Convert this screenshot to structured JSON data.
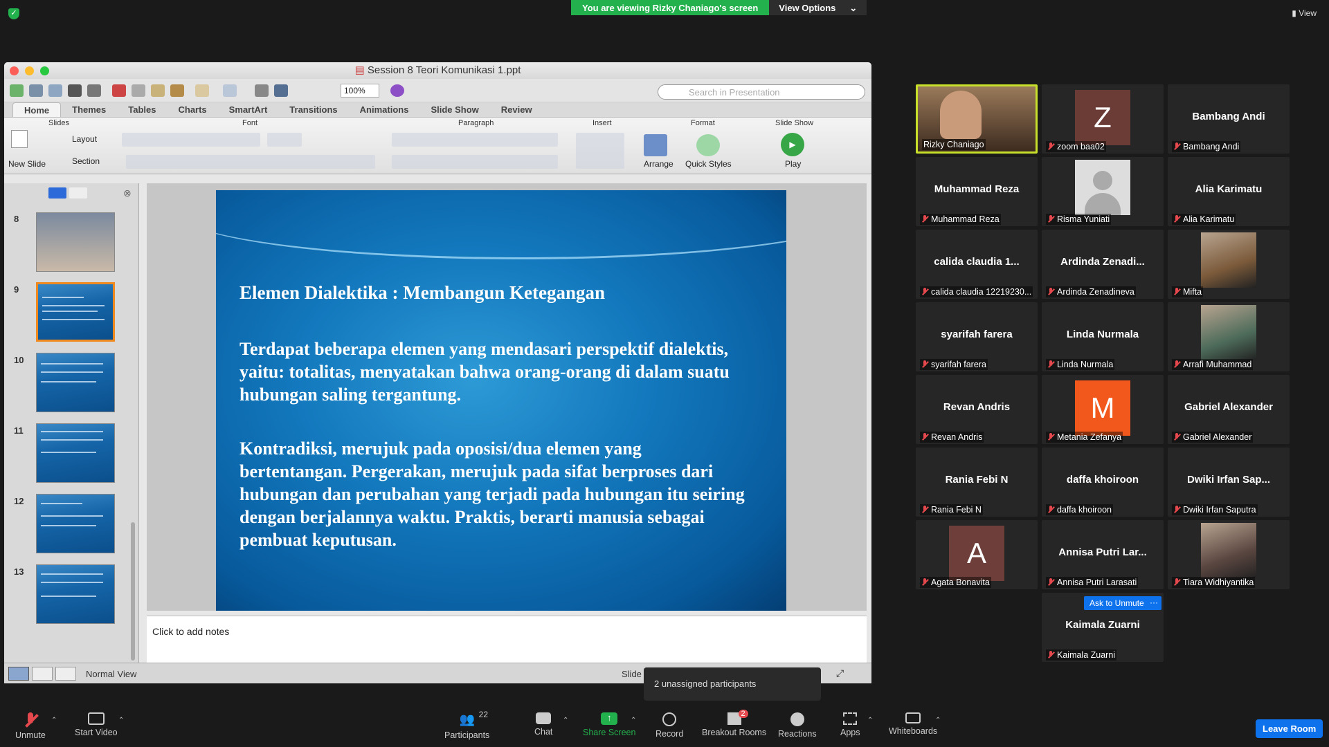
{
  "zoom_top": {
    "banner": "You are viewing Rizky Chaniago's screen",
    "view_options": "View Options",
    "view": "View"
  },
  "ppt": {
    "title": "Session 8 Teori Komunikasi 1.ppt",
    "zoom": "100%",
    "search_placeholder": "Search in Presentation",
    "tabs": [
      "Home",
      "Themes",
      "Tables",
      "Charts",
      "SmartArt",
      "Transitions",
      "Animations",
      "Slide Show",
      "Review"
    ],
    "groups": {
      "slides": "Slides",
      "font": "Font",
      "paragraph": "Paragraph",
      "insert": "Insert",
      "format": "Format",
      "slideshow": "Slide Show"
    },
    "buttons": {
      "new_slide": "New Slide",
      "layout": "Layout",
      "section": "Section",
      "arrange": "Arrange",
      "quick_styles": "Quick Styles",
      "play": "Play"
    },
    "thumb_numbers": [
      "8",
      "9",
      "10",
      "11",
      "12",
      "13"
    ],
    "slide": {
      "title": "Elemen Dialektika : Membangun Ketegangan",
      "p1": "Terdapat beberapa elemen yang mendasari perspektif dialektis, yaitu: totalitas, menyatakan bahwa orang-orang di dalam suatu hubungan saling tergantung.",
      "p2": "Kontradiksi, merujuk pada oposisi/dua elemen yang bertentangan. Pergerakan, merujuk pada sifat berproses dari hubungan dan perubahan yang terjadi pada hubungan itu seiring dengan berjalannya waktu. Praktis, berarti manusia sebagai pembuat keputusan."
    },
    "notes": "Click to add notes",
    "status_view": "Normal View",
    "status_slide": "Slide"
  },
  "participants": [
    {
      "big": "",
      "name": "Rizky Chaniago",
      "type": "video"
    },
    {
      "big": "",
      "name": "zoom baa02",
      "type": "avatar",
      "letter": "Z",
      "color": "#6b3b35"
    },
    {
      "big": "Bambang Andi",
      "name": "Bambang Andi",
      "type": "text"
    },
    {
      "big": "Muhammad Reza",
      "name": "Muhammad Reza",
      "type": "text"
    },
    {
      "big": "",
      "name": "Risma Yuniati",
      "type": "default"
    },
    {
      "big": "Alia Karimatu",
      "name": "Alia Karimatu",
      "type": "text"
    },
    {
      "big": "calida claudia 1...",
      "name": "calida claudia 12219230...",
      "type": "text"
    },
    {
      "big": "Ardinda Zenadi...",
      "name": "Ardinda Zenadineva",
      "type": "text"
    },
    {
      "big": "",
      "name": "Mifta",
      "type": "photo",
      "color": "#7b5a3a"
    },
    {
      "big": "syarifah farera",
      "name": "syarifah farera",
      "type": "text"
    },
    {
      "big": "Linda Nurmala",
      "name": "Linda Nurmala",
      "type": "text"
    },
    {
      "big": "",
      "name": "Arrafi Muhammad",
      "type": "photo",
      "color": "#4d6b5a"
    },
    {
      "big": "Revan Andris",
      "name": "Revan Andris",
      "type": "text"
    },
    {
      "big": "",
      "name": "Metania Zefanya",
      "type": "avatar",
      "letter": "M",
      "color": "#f2581c"
    },
    {
      "big": "Gabriel Alexander",
      "name": "Gabriel Alexander",
      "type": "text"
    },
    {
      "big": "Rania Febi N",
      "name": "Rania Febi N",
      "type": "text"
    },
    {
      "big": "daffa khoiroon",
      "name": "daffa khoiroon",
      "type": "text"
    },
    {
      "big": "Dwiki Irfan Sap...",
      "name": "Dwiki Irfan Saputra",
      "type": "text"
    },
    {
      "big": "",
      "name": "Agata Bonavita",
      "type": "avatar",
      "letter": "A",
      "color": "#6e3f3a"
    },
    {
      "big": "Annisa Putri Lar...",
      "name": "Annisa Putri Larasati",
      "type": "text"
    },
    {
      "big": "",
      "name": "Tiara Widhiyantika",
      "type": "photo",
      "color": "#5a4640"
    },
    {
      "big": "Kaimala Zuarni",
      "name": "Kaimala Zuarni",
      "type": "text"
    }
  ],
  "ask_unmute": "Ask to Unmute",
  "ask_more": "···",
  "tooltip": "2 unassigned participants",
  "bottom": {
    "unmute": "Unmute",
    "start_video": "Start Video",
    "participants": "Participants",
    "participants_count": "22",
    "chat": "Chat",
    "share": "Share Screen",
    "record": "Record",
    "breakout": "Breakout Rooms",
    "breakout_badge": "2",
    "reactions": "Reactions",
    "apps": "Apps",
    "whiteboards": "Whiteboards",
    "leave": "Leave Room"
  },
  "colors": {
    "zoom_green": "#23b14d",
    "zoom_blue": "#0e72ed",
    "mute_red": "#e5484d",
    "active_speaker": "#c8e02a"
  }
}
